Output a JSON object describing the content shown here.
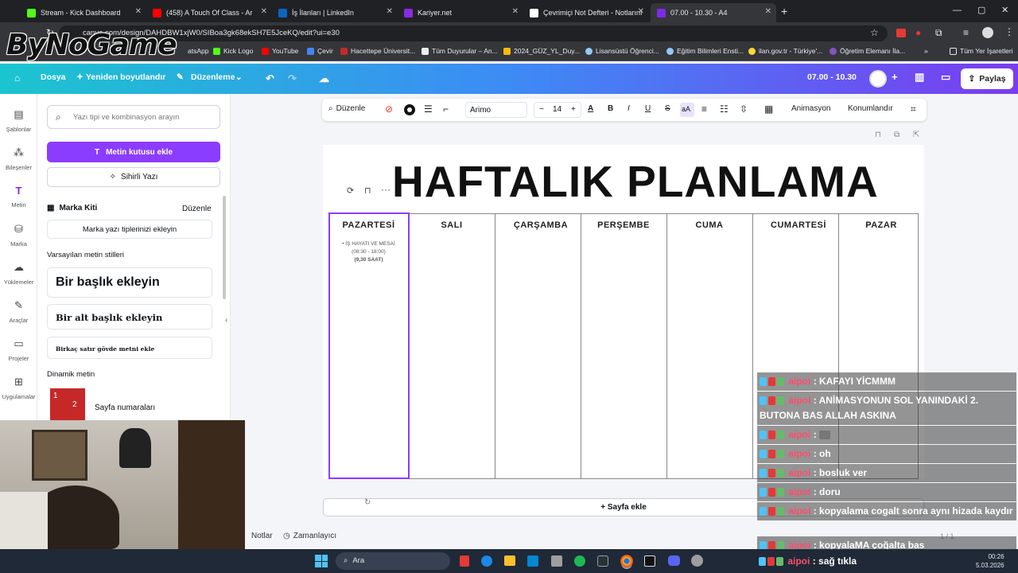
{
  "browser": {
    "tabs": [
      {
        "label": "Stream - Kick Dashboard",
        "color": "#53fc18"
      },
      {
        "label": "(458) A Touch Of Class - Ar",
        "color": "#ff0000"
      },
      {
        "label": "İş İlanları | LinkedIn",
        "color": "#0a66c2"
      },
      {
        "label": "Kariyer.net",
        "color": "#8a2be2"
      },
      {
        "label": "Çevrimiçi Not Defteri - Notlarını",
        "color": "#ffffff"
      },
      {
        "label": "07.00 - 10.30 - A4",
        "color": "#7d2ae8"
      }
    ],
    "url": "canva.com/design/DAHDBW1xjW0/SIBoa3gk68ekSH7E5JceKQ/edit?ui=e30",
    "bookmarks": [
      "atsApp",
      "Kick Logo",
      "YouTube",
      "Çevir",
      "Hacettepe Üniversit...",
      "Tüm Duyurular – An...",
      "2024_GÜZ_YL_Duy...",
      "Lisansüstü Öğrenci...",
      "Eğitim Bilimleri Ensti...",
      "ilan.gov.tr - Türkiye'...",
      "Öğretim Elemanı İla...",
      "Tüm Yer İşaretleri"
    ]
  },
  "watermark": "ByNoGame",
  "canva_bar": {
    "file": "Dosya",
    "resize": "Yeniden boyutlandır",
    "edit": "Düzenleme",
    "doc_title": "07.00 - 10.30",
    "share": "Paylaş"
  },
  "side_nav": [
    "Şablonlar",
    "Bileşenler",
    "Metin",
    "Marka",
    "Yüklemeler",
    "Araçlar",
    "Projeler",
    "Uygulamalar"
  ],
  "text_panel": {
    "search_placeholder": "Yazı tipi ve kombinasyon arayın",
    "add_textbox": "Metin kutusu ekle",
    "magic_text": "Sihirli Yazı",
    "brand_kit": "Marka Kiti",
    "brand_edit": "Düzenle",
    "brand_fonts": "Marka yazı tiplerinizi ekleyin",
    "default_styles": "Varsayılan metin stilleri",
    "heading": "Bir başlık ekleyin",
    "subheading": "Bir alt başlık ekleyin",
    "body": "Birkaç satır gövde metni ekle",
    "dynamic": "Dinamik metin",
    "page_numbers": "Sayfa numaraları"
  },
  "text_toolbar": {
    "edit": "Düzenle",
    "font": "Arimo",
    "size": "14",
    "minus": "−",
    "plus": "+",
    "animation": "Animasyon",
    "position": "Konumlandır"
  },
  "design": {
    "title": "HAFTALIK PLANLAMA",
    "days": [
      "PAZARTESİ",
      "SALI",
      "ÇARŞAMBA",
      "PERŞEMBE",
      "CUMA",
      "CUMARTESİ",
      "PAZAR"
    ],
    "monday_entry": [
      "İŞ HAYATI VE MESAİ",
      "(08:30 - 18:00)",
      "(9,30 SAAT)"
    ],
    "add_page": "+ Sayfa ekle"
  },
  "footer": {
    "notes": "Notlar",
    "timer": "Zamanlayıcı",
    "page_count": "1 / 1"
  },
  "chat": [
    {
      "user": "aipoi",
      "text": "KAFAYI YİCMMM"
    },
    {
      "user": "aipoi",
      "text": "ANİMASYONUN SOL YANINDAKİ 2. BUTONA BAS ALLAH ASKINA"
    },
    {
      "user": "aipoi",
      "text": ""
    },
    {
      "user": "aipoi",
      "text": "oh"
    },
    {
      "user": "aipoi",
      "text": "bosluk ver"
    },
    {
      "user": "aipoi",
      "text": "doru"
    },
    {
      "user": "aipoi",
      "text": "kopyalama cogalt sonra aynı hizada kaydır"
    },
    {
      "user": "aipoi",
      "text": "kopyalaMA çoğalta bas"
    },
    {
      "user": "aipoi",
      "text": "sağ tıkla"
    }
  ],
  "taskbar": {
    "search": "Ara",
    "time": "00:26",
    "date": "5.03.2026"
  }
}
